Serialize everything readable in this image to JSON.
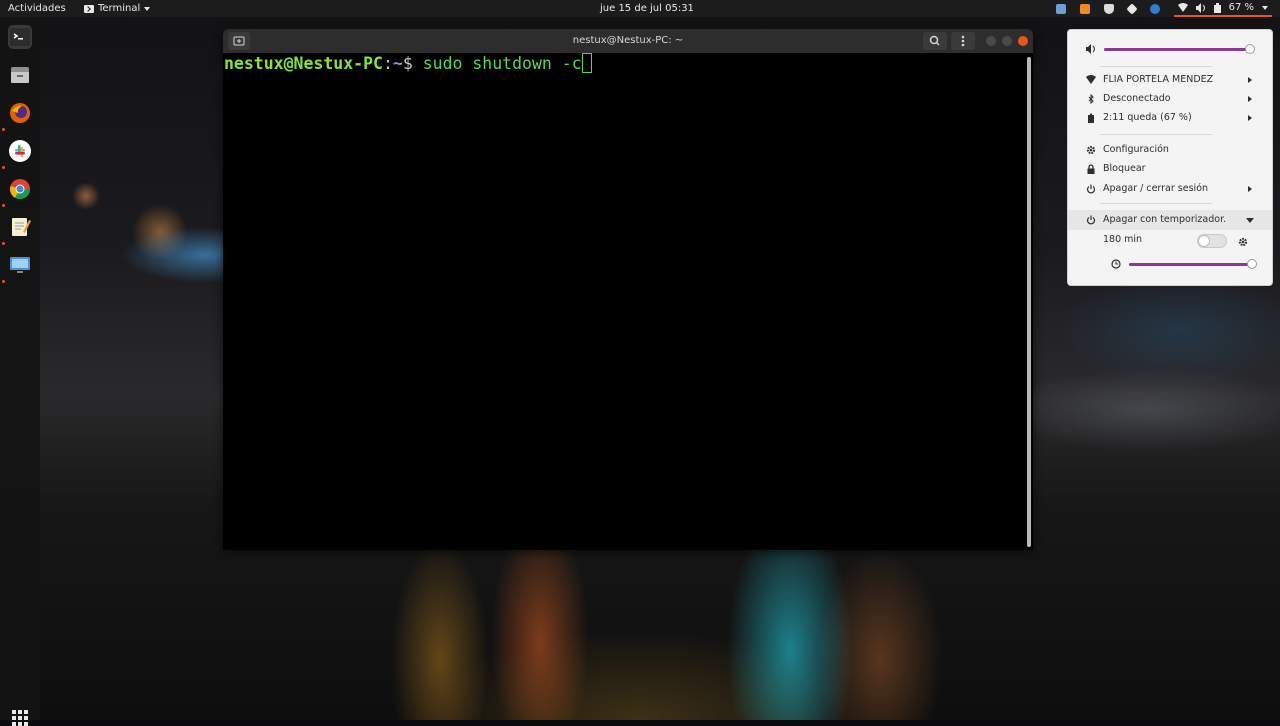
{
  "topbar": {
    "activities": "Actividades",
    "app_name": "Terminal",
    "clock": "jue 15 de jul  05:31",
    "battery": "67 %",
    "tray_icons": [
      "screenshot-tool-icon",
      "sublime-icon",
      "coffee-icon",
      "slack-icon",
      "skype-icon"
    ]
  },
  "dock": {
    "items": [
      "terminal",
      "files",
      "firefox",
      "slack",
      "chrome",
      "text-editor",
      "remote-desktop"
    ],
    "accent": "#e9541f"
  },
  "terminal": {
    "title": "nestux@Nestux-PC: ~",
    "prompt_user": "nestux@Nestux-PC",
    "prompt_sep": ":",
    "prompt_path": "~",
    "prompt_symbol": "$",
    "command": " sudo shutdown -c",
    "colors": {
      "user": "#8ae234",
      "path": "#729fcf",
      "text": "#c8c8c8",
      "command": "#57d55b"
    }
  },
  "system_menu": {
    "volume": 0.97,
    "wifi": "FLIA PORTELA MENDEZ",
    "bluetooth": "Desconectado",
    "battery": "2:11 queda (67 %)",
    "settings": "Configuración",
    "lock": "Bloquear",
    "power": "Apagar / cerrar sesión",
    "timer": "Apagar con temporizador.",
    "timer_minutes": "180 min",
    "timer_enabled": false,
    "timer_level": 0.98,
    "accent": "#8b3a92"
  }
}
